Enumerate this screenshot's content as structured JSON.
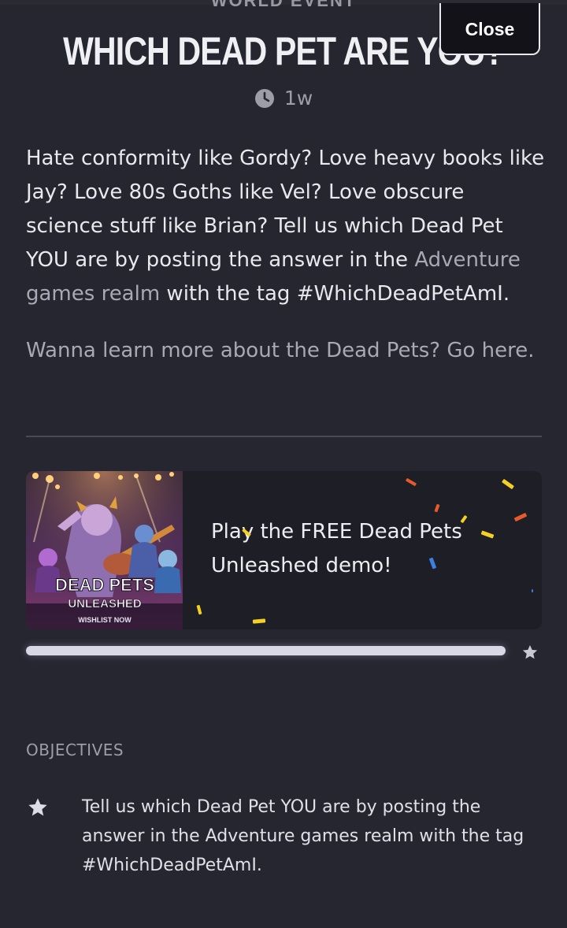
{
  "event": {
    "kicker": "WORLD EVENT",
    "title": "WHICH DEAD PET ARE YOU?",
    "age": "1w"
  },
  "close_label": "Close",
  "description": {
    "part1": "Hate conformity like Gordy? Love heavy books like Jay? Love 80s Goths like Vel? Love obscure science stuff like Brian? Tell us which Dead Pet YOU are by posting the answer in the ",
    "link": "Adventure games realm",
    "part2": " with the tag #WhichDeadPetAmI."
  },
  "learn_more": "Wanna learn more about the Dead Pets? Go here.",
  "promo": {
    "text": "Play the FREE Dead Pets Unleashed demo!",
    "art_title": "DEAD PETS",
    "art_subtitle": "UNLEASHED",
    "art_tagline": "WISHLIST NOW"
  },
  "progress": {
    "fraction": 1.0
  },
  "objectives": {
    "heading": "OBJECTIVES",
    "items": [
      "Tell us which Dead Pet YOU are by posting the answer in the Adventure games realm with the tag #WhichDeadPetAmI."
    ]
  },
  "colors": {
    "background": "#262630",
    "card": "#1e1e26",
    "muted_text": "#9d9da8",
    "progress": "#d8d8e6"
  }
}
